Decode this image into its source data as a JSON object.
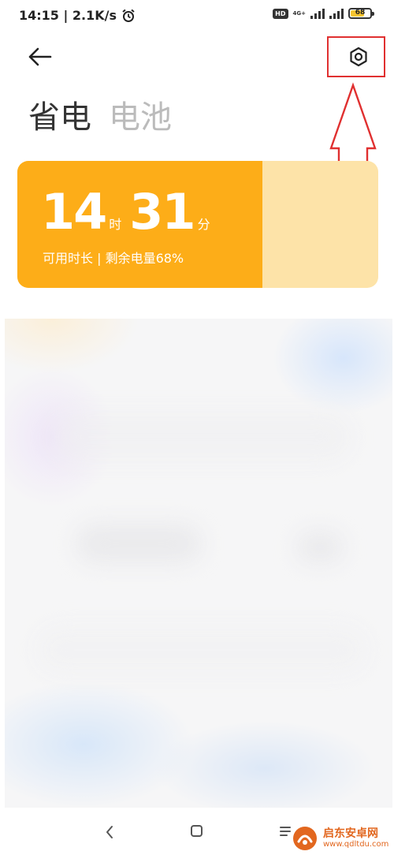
{
  "status_bar": {
    "time_speed": "14:15 | 2.1K/s",
    "hd_label": "HD",
    "network_label": "4G+",
    "battery_level": "68"
  },
  "header": {
    "back_icon": "arrow-left-icon",
    "settings_icon": "hexagon-gear-icon"
  },
  "tabs": [
    {
      "label": "省电",
      "active": true
    },
    {
      "label": "电池",
      "active": false
    }
  ],
  "battery_card": {
    "hours": "14",
    "hours_unit": "时",
    "minutes": "31",
    "minutes_unit": "分",
    "subtitle": "可用时长 | 剩余电量68%",
    "remaining_fraction": 0.68,
    "fill_color": "#fdad18",
    "track_color": "#fde3a8"
  },
  "annotation": {
    "color": "#e03030"
  },
  "nav_bar": {
    "back_icon": "chevron-left-icon",
    "home_icon": "square-home-icon",
    "menu_icon": "menu-lines-icon"
  },
  "watermark": {
    "name": "启东安卓网",
    "url": "www.qdltdu.com"
  }
}
